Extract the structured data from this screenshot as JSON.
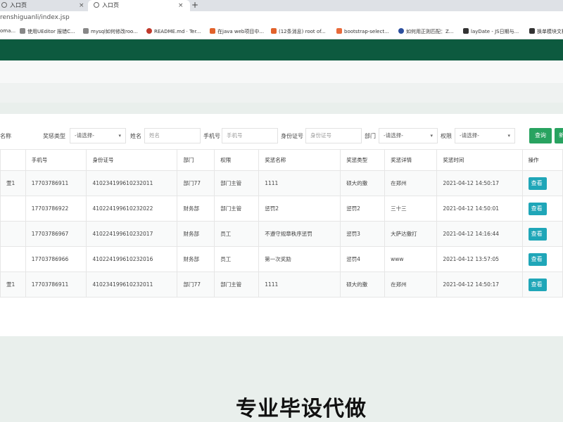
{
  "browser": {
    "tabs": [
      {
        "title": "入口页",
        "close": "×"
      },
      {
        "title": "入口页",
        "close": "×"
      }
    ],
    "new_tab": "+",
    "url": "renshiguanli/index.jsp",
    "bookmarks": [
      {
        "label": "oma...",
        "color": "#4a76c9"
      },
      {
        "label": "使用UEditor 报错C...",
        "color": "#666666"
      },
      {
        "label": "mysql如何修改roo...",
        "color": "#666666"
      },
      {
        "label": "README.md · Ter...",
        "color": "#c0392b"
      },
      {
        "label": "在java web项目中...",
        "color": "#e2622b"
      },
      {
        "label": "(12条消息) root of...",
        "color": "#e2622b"
      },
      {
        "label": "bootstrap-select...",
        "color": "#e86a3a"
      },
      {
        "label": "如何用正则匹配：Z...",
        "color": "#2c4f9e"
      },
      {
        "label": "layDate - JS日期与...",
        "color": "#333333"
      },
      {
        "label": "换单模块文档",
        "color": "#333333"
      }
    ]
  },
  "search": {
    "name_partial": "名称",
    "award_type_label": "奖惩类型",
    "award_type_value": "-请选择-",
    "name_label": "姓名",
    "name_placeholder": "姓名",
    "phone_label": "手机号",
    "phone_placeholder": "手机号",
    "id_label": "身份证号",
    "id_placeholder": "身份证号",
    "dept_label": "部门",
    "dept_value": "-请选择-",
    "role_label": "权限",
    "role_value": "-请选择-",
    "query_button": "查询",
    "more_button": "新"
  },
  "table": {
    "headers": [
      "",
      "手机号",
      "身份证号",
      "部门",
      "权限",
      "奖惩名称",
      "奖惩类型",
      "奖惩详情",
      "奖惩时间",
      "操作"
    ],
    "rows": [
      {
        "c0": "萱1",
        "phone": "17703786911",
        "id": "410234199610232011",
        "dept": "部门77",
        "role": "部门主管",
        "name": "1111",
        "type": "硕大的撒",
        "detail": "在郑州",
        "time": "2021-04-12 14:50:17",
        "action": "查看"
      },
      {
        "c0": "",
        "phone": "17703786922",
        "id": "410224199610232022",
        "dept": "财务部",
        "role": "部门主管",
        "name": "惩罚2",
        "type": "惩罚2",
        "detail": "三十三",
        "time": "2021-04-12 14:50:01",
        "action": "查看"
      },
      {
        "c0": "",
        "phone": "17703786967",
        "id": "410224199610232017",
        "dept": "财务部",
        "role": "员工",
        "name": "不遵守规章秩序惩罚",
        "type": "惩罚3",
        "detail": "大萨达撒打",
        "time": "2021-04-12 14:16:44",
        "action": "查看"
      },
      {
        "c0": "",
        "phone": "17703786966",
        "id": "410224199610232016",
        "dept": "财务部",
        "role": "员工",
        "name": "第一次奖励",
        "type": "惩罚4",
        "detail": "www",
        "time": "2021-04-12 13:57:05",
        "action": "查看"
      },
      {
        "c0": "萱1",
        "phone": "17703786911",
        "id": "410234199610232011",
        "dept": "部门77",
        "role": "部门主管",
        "name": "1111",
        "type": "硕大的撒",
        "detail": "在郑州",
        "time": "2021-04-12 14:50:17",
        "action": "查看"
      }
    ]
  },
  "watermark": "专业毕设代做"
}
